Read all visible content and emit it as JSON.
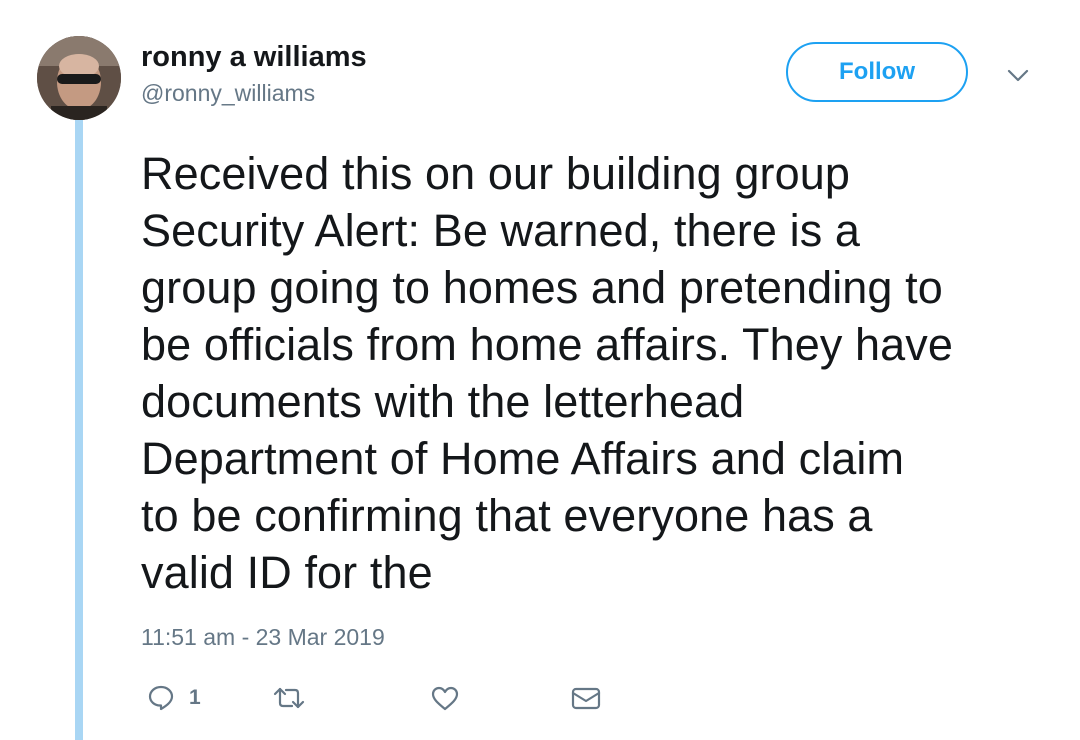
{
  "user": {
    "display_name": "ronny a williams",
    "handle": "@ronny_williams"
  },
  "follow_button": {
    "label": "Follow"
  },
  "tweet": {
    "text_lines": [
      "Received this on our building group",
      "Security Alert: Be warned, there is a",
      "group going to homes and pretending to",
      "be officials from home affairs. They have",
      "documents with the letterhead",
      "Department of Home Affairs and claim",
      "to be confirming that everyone has a",
      "valid ID for the"
    ],
    "timestamp": "11:51 am - 23 Mar 2019"
  },
  "actions": {
    "reply_count": "1",
    "icons": [
      "reply-icon",
      "retweet-icon",
      "like-icon",
      "direct-message-icon"
    ]
  },
  "colors": {
    "accent": "#1da1f2",
    "thread_line": "#a9d6f4",
    "secondary_text": "#657786",
    "primary_text": "#14171a"
  }
}
